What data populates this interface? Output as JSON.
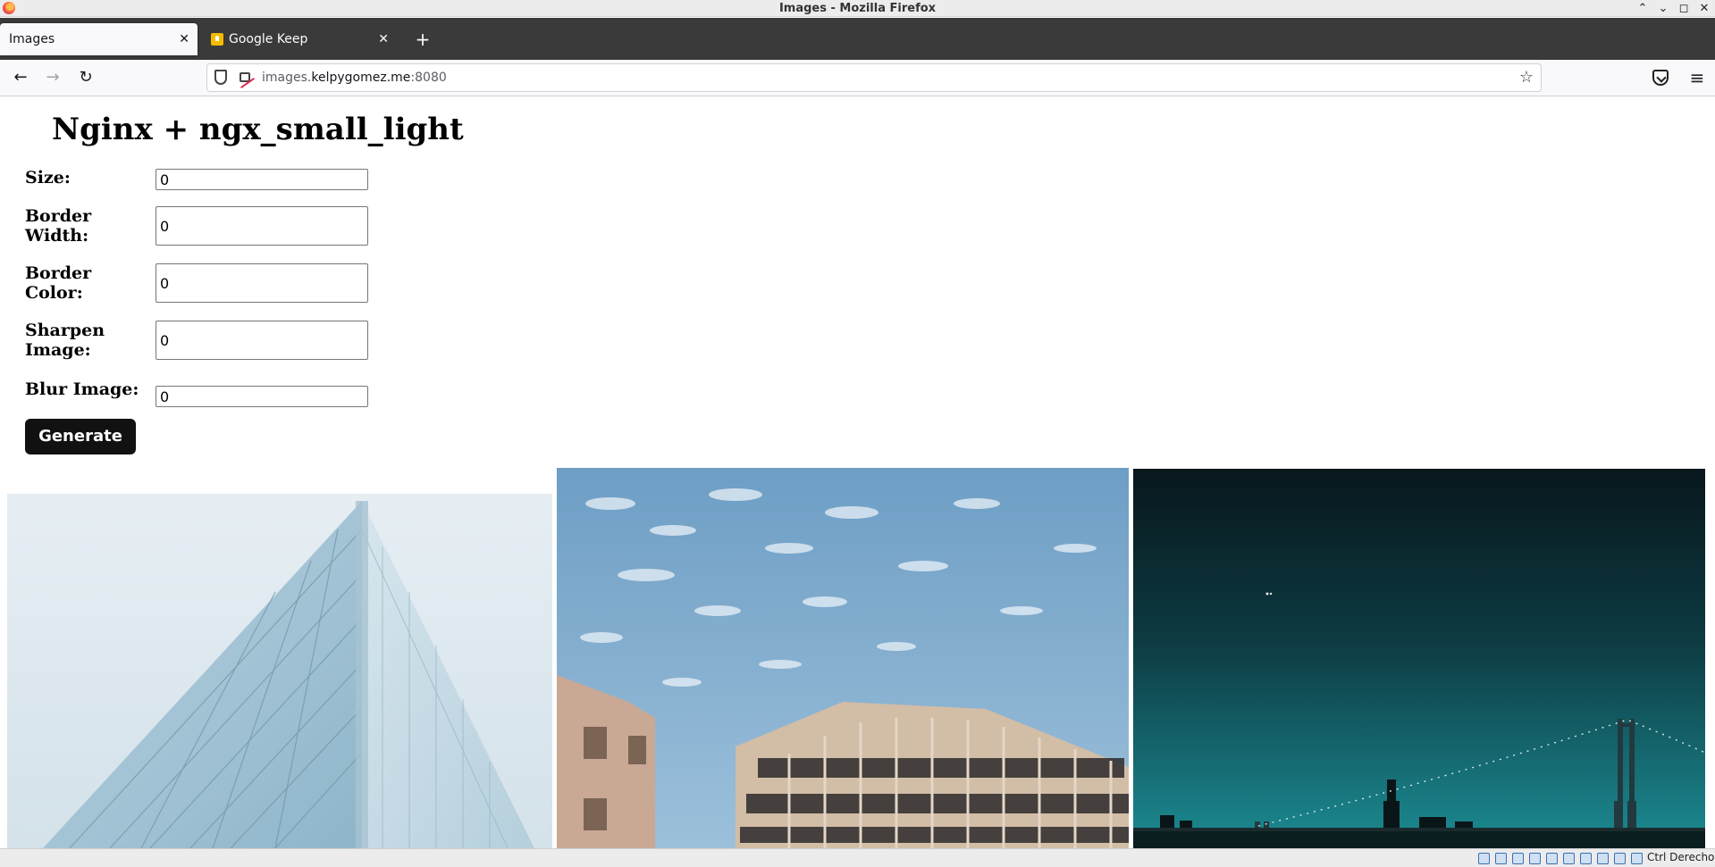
{
  "window": {
    "title": "Images - Mozilla Firefox",
    "controls": [
      "⌃",
      "⌄",
      "◻",
      "✕"
    ]
  },
  "tabs": [
    {
      "label": "Images",
      "active": true
    },
    {
      "label": "Google Keep",
      "active": false
    }
  ],
  "toolbar": {
    "back_glyph": "←",
    "forward_glyph": "→",
    "reload_glyph": "↻",
    "newtab_glyph": "+",
    "close_glyph": "✕",
    "star_glyph": "☆",
    "menu_glyph": "≡"
  },
  "address": {
    "prefix": "images.",
    "domain": "kelpygomez.me",
    "port": ":8080"
  },
  "page": {
    "title": "Nginx + ngx_small_light",
    "fields": [
      {
        "label": "Size:",
        "value": "0"
      },
      {
        "label": "Border Width:",
        "value": "0"
      },
      {
        "label": "Border Color:",
        "value": "0"
      },
      {
        "label": "Sharpen Image:",
        "value": "0"
      },
      {
        "label": "Blur Image:",
        "value": "0"
      }
    ],
    "generate_label": "Generate",
    "images": [
      {
        "icon": "glass-building-photo"
      },
      {
        "icon": "sky-buildings-photo"
      },
      {
        "icon": "night-bridge-photo"
      }
    ]
  },
  "statusbar": {
    "host_key_label": "Ctrl Derecho"
  },
  "colors": {
    "tabstrip_bg": "#3a3a3a",
    "button_bg": "#111111",
    "accent_orange": "#ff7139"
  }
}
